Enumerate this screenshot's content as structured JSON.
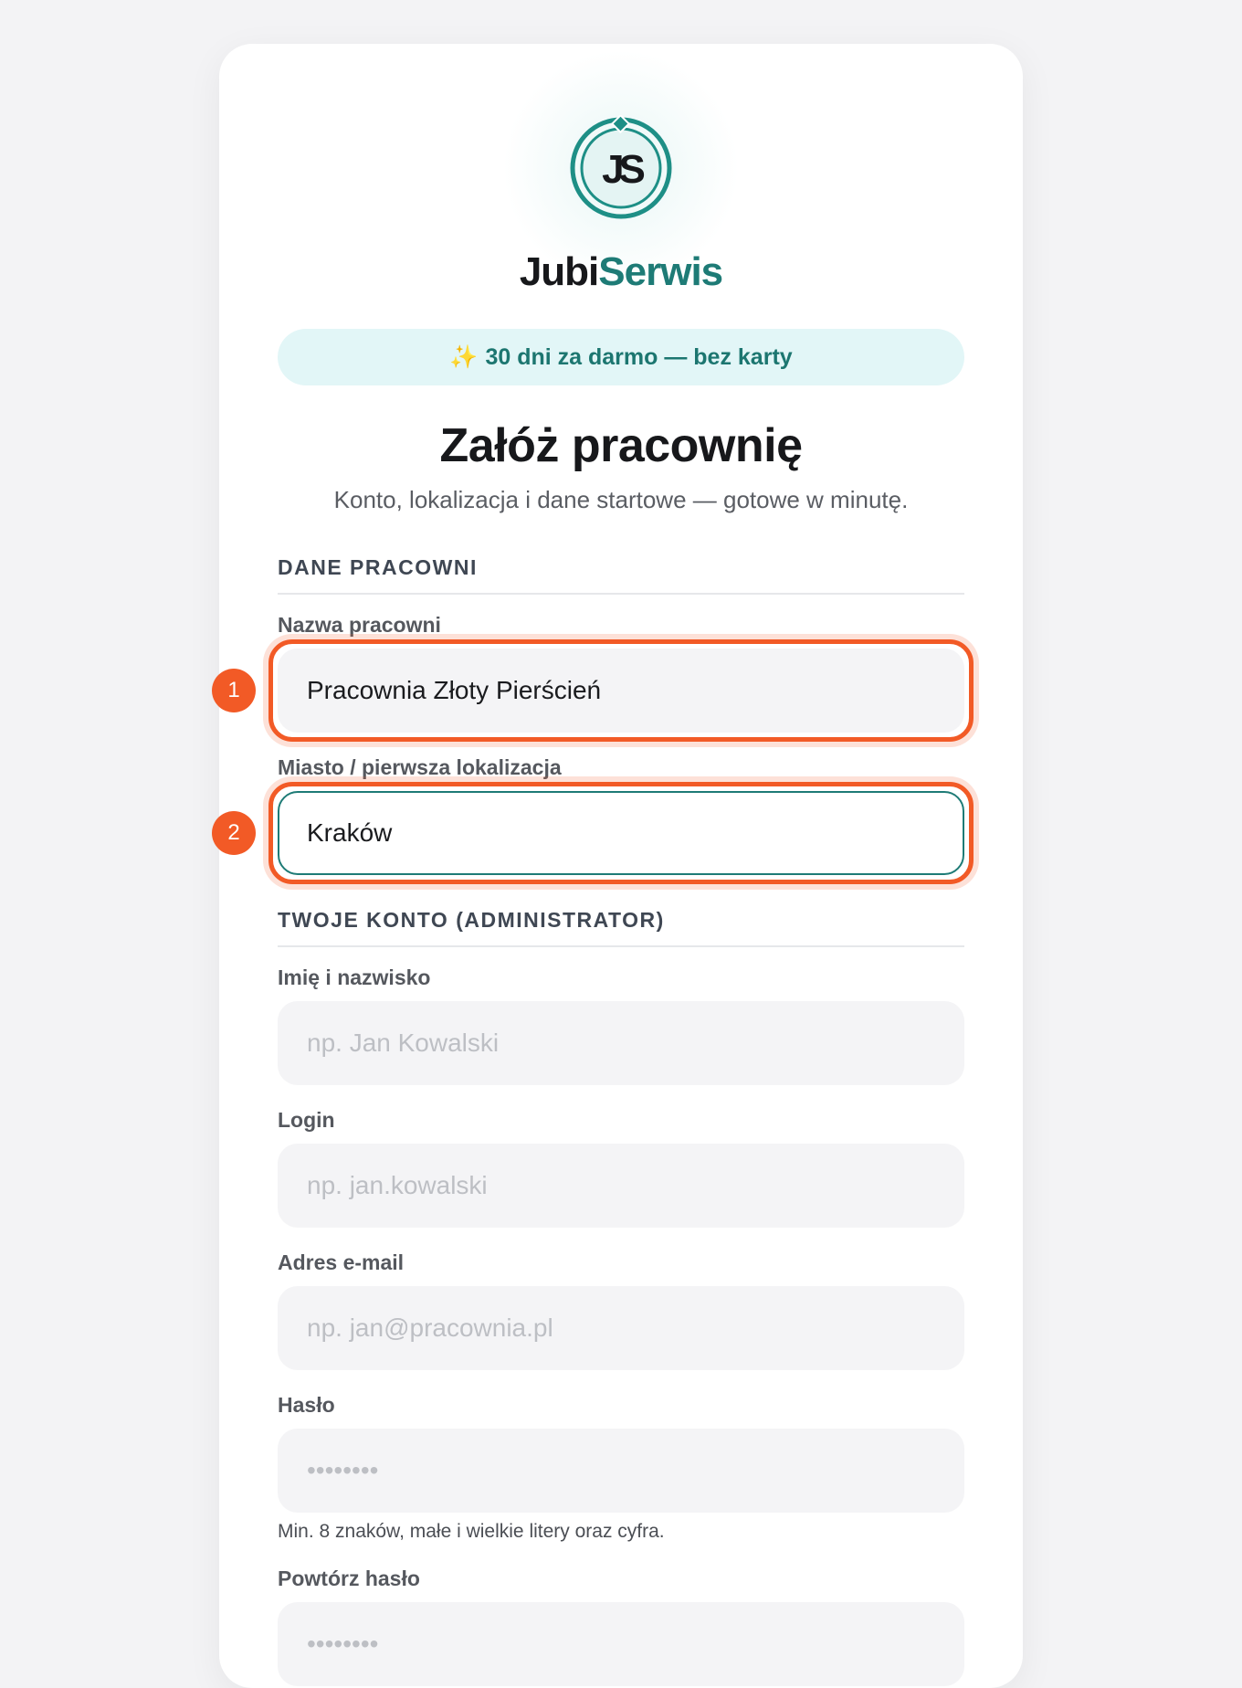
{
  "brand": {
    "name_part1": "Jubi",
    "name_part2": "Serwis",
    "logo_text": "JS"
  },
  "promo": {
    "icon": "sparkles-icon",
    "icon_glyph": "✨",
    "text": "30 dni za darmo — bez karty"
  },
  "header": {
    "title": "Załóż pracownię",
    "subtitle": "Konto, lokalizacja i dane startowe — gotowe w minutę."
  },
  "sections": {
    "workshop": "DANE PRACOWNI",
    "account": "TWOJE KONTO (ADMINISTRATOR)"
  },
  "fields": {
    "workshop_name": {
      "label": "Nazwa pracowni",
      "value": "Pracownia Złoty Pierścień",
      "placeholder": ""
    },
    "city": {
      "label": "Miasto / pierwsza lokalizacja",
      "value": "Kraków",
      "placeholder": ""
    },
    "full_name": {
      "label": "Imię i nazwisko",
      "value": "",
      "placeholder": "np. Jan Kowalski"
    },
    "login": {
      "label": "Login",
      "value": "",
      "placeholder": "np. jan.kowalski"
    },
    "email": {
      "label": "Adres e-mail",
      "value": "",
      "placeholder": "np. jan@pracownia.pl"
    },
    "password": {
      "label": "Hasło",
      "value": "",
      "placeholder": "••••••••",
      "hint": "Min. 8 znaków, małe i wielkie litery oraz cyfra."
    },
    "password_repeat": {
      "label": "Powtórz hasło",
      "value": "",
      "placeholder": "••••••••"
    }
  },
  "annotations": {
    "marker1": "1",
    "marker2": "2"
  },
  "colors": {
    "accent": "#1e7b76",
    "highlight": "#f25a26",
    "promo_bg": "#e2f6f7"
  }
}
